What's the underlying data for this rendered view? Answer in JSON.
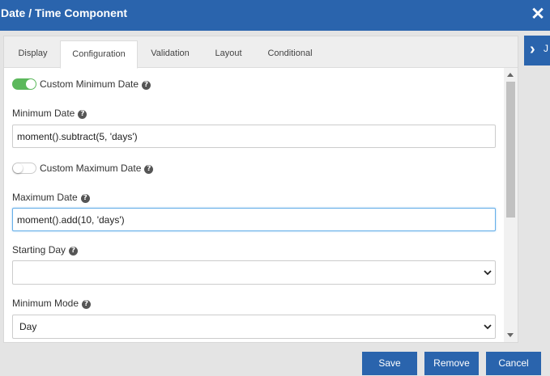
{
  "dialog": {
    "title": "Date / Time Component",
    "close_glyph": "✕"
  },
  "side_panel": {
    "chevron": "›",
    "peek_text": "J"
  },
  "tabs": [
    {
      "label": "Display",
      "active": false
    },
    {
      "label": "Configuration",
      "active": true
    },
    {
      "label": "Validation",
      "active": false
    },
    {
      "label": "Layout",
      "active": false
    },
    {
      "label": "Conditional",
      "active": false
    }
  ],
  "form": {
    "custom_min_date": {
      "label": "Custom Minimum Date",
      "enabled": true
    },
    "minimum_date": {
      "label": "Minimum Date",
      "value": "moment().subtract(5, 'days')"
    },
    "custom_max_date": {
      "label": "Custom Maximum Date",
      "enabled": false
    },
    "maximum_date": {
      "label": "Maximum Date",
      "value": "moment().add(10, 'days')"
    },
    "starting_day": {
      "label": "Starting Day",
      "value": ""
    },
    "minimum_mode": {
      "label": "Minimum Mode",
      "value": "Day"
    }
  },
  "help_glyph": "?",
  "buttons": {
    "save": "Save",
    "remove": "Remove",
    "cancel": "Cancel"
  },
  "colors": {
    "primary": "#2a64ad",
    "toggle_on": "#5cb85c",
    "focus": "#66afe9"
  }
}
